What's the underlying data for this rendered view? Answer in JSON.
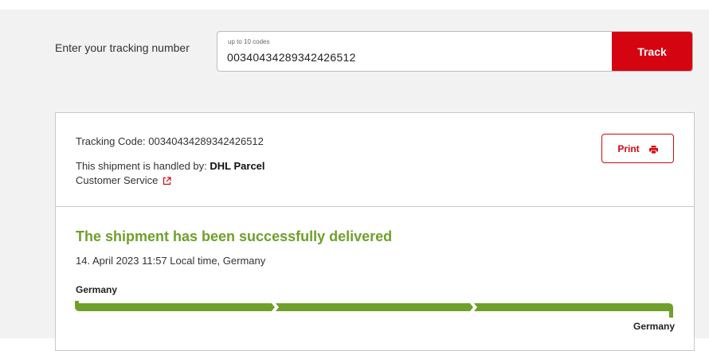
{
  "tracking_form": {
    "label": "Enter your tracking number",
    "hint": "up to 10 codes",
    "value": "00340434289342426512",
    "button_label": "Track"
  },
  "shipment": {
    "tracking_code_label": "Tracking Code:",
    "tracking_code": "00340434289342426512",
    "handled_by_label": "This shipment is handled by:",
    "handled_by": "DHL Parcel",
    "customer_service_label": "Customer Service",
    "print_label": "Print"
  },
  "status": {
    "title": "The shipment has been successfully delivered",
    "timestamp": "14. April 2023 11:57 Local time, Germany",
    "origin": "Germany",
    "destination": "Germany",
    "progress_steps_completed": 3,
    "progress_steps_total": 3
  },
  "colors": {
    "brand_red": "#d40511",
    "success_green": "#6fa02a"
  },
  "icons": {
    "external_link": "external-link-icon",
    "printer": "printer-icon"
  }
}
